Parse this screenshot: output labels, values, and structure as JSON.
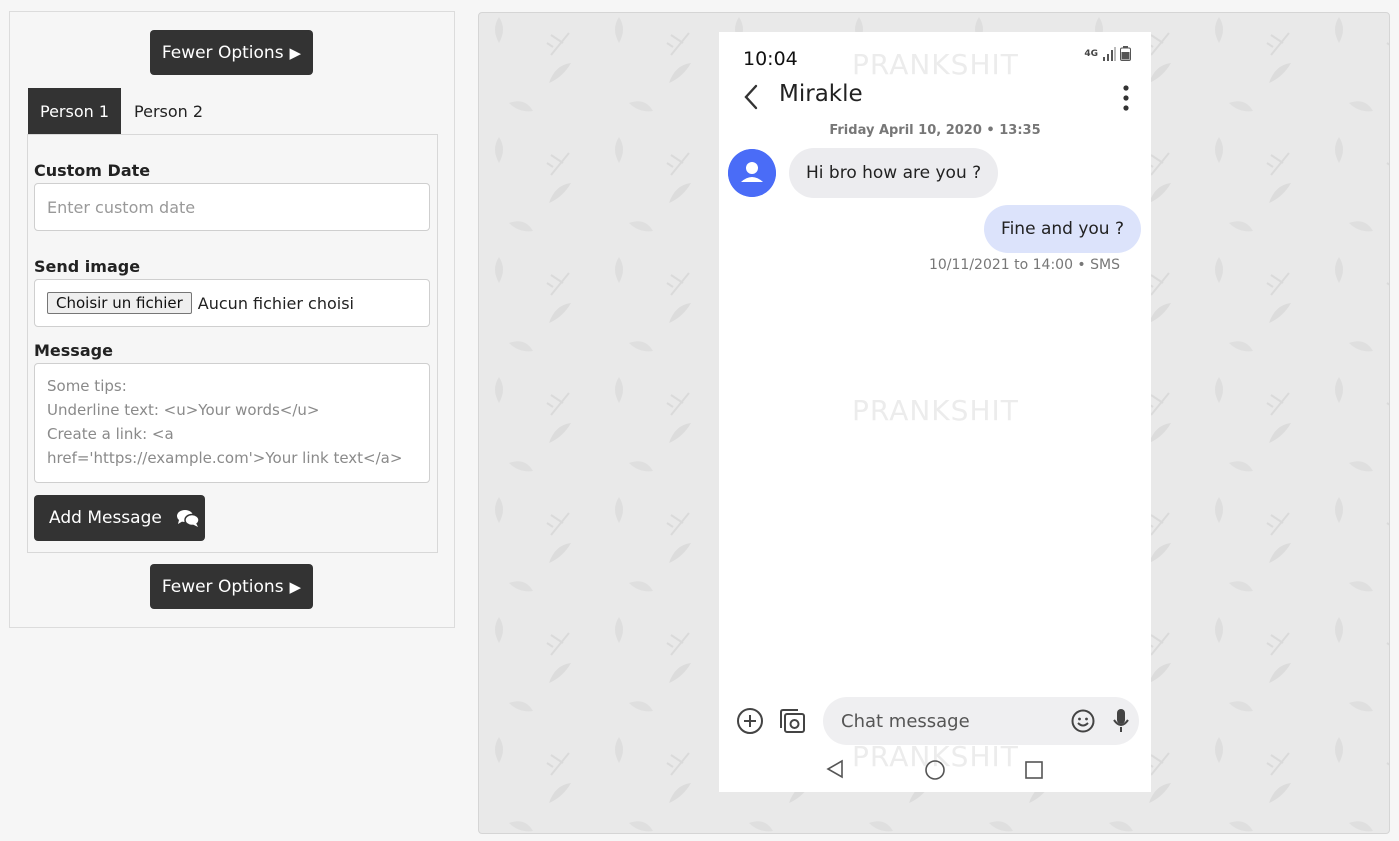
{
  "controls": {
    "fewer_options_label": "Fewer Options",
    "tabs": [
      {
        "label": "Person 1",
        "active": true
      },
      {
        "label": "Person 2",
        "active": false
      }
    ],
    "custom_date": {
      "label": "Custom Date",
      "placeholder": "Enter custom date"
    },
    "send_image": {
      "label": "Send image",
      "button_label": "Choisir un fichier",
      "status": "Aucun fichier choisi"
    },
    "message": {
      "label": "Message",
      "placeholder_lines": [
        "Some tips:",
        "Underline text: <u>Your words</u>",
        "Create a link: <a",
        "href='https://example.com'>Your link text</a>"
      ]
    },
    "add_message_label": "Add Message"
  },
  "phone": {
    "watermark": "PRANKSHIT",
    "status_time": "10:04",
    "network_label": "4G",
    "contact_name": "Mirakle",
    "date_line": "Friday April 10, 2020 • 13:35",
    "messages": [
      {
        "direction": "incoming",
        "text": "Hi bro how are you ?"
      },
      {
        "direction": "outgoing",
        "text": "Fine and you ?"
      }
    ],
    "message_meta": "10/11/2021 to 14:00 • SMS",
    "chat_placeholder": "Chat message",
    "colors": {
      "avatar": "#4a6cf7",
      "outgoing_bubble": "#dce3fb",
      "incoming_bubble": "#ececef",
      "dark_button": "#333333"
    }
  }
}
